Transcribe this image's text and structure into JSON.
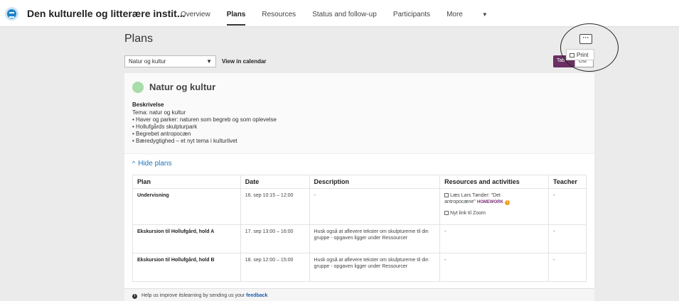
{
  "header": {
    "course_title": "Den kulturelle og litterære instit...",
    "nav": [
      "Overview",
      "Plans",
      "Resources",
      "Status and follow-up",
      "Participants",
      "More"
    ],
    "active_nav": "Plans"
  },
  "page": {
    "title": "Plans",
    "plan_select": "Natur og kultur",
    "calendar_link": "View in calendar",
    "view_toggle": [
      "Tab",
      "List"
    ],
    "more_button": "···",
    "print_label": "Print"
  },
  "plan": {
    "name": "Natur og kultur",
    "dot_color": "#a8dca8",
    "description_label": "Beskrivelse",
    "description_lines": [
      "Tema: natur og kultur",
      "• Haver og parker: naturen som begreb og som oplevelse",
      "• Hollufgårds skulpturpark",
      "• Begrebet antropocæn",
      "• Bæredygtighed – et nyt tema i kulturlivet"
    ],
    "hide_plans_label": "Hide plans"
  },
  "table": {
    "headers": [
      "Plan",
      "Date",
      "Description",
      "Resources and activities",
      "Teacher"
    ],
    "rows": [
      {
        "plan": "Undervisning",
        "date": "16. sep 10:15 – 12:00",
        "description": "-",
        "resource_1": "Læs Lars Tønder: \"Det antropocæne\"",
        "resource_1_tag": "HOMEWORK",
        "resource_2": "Nyt link til Zoom",
        "teacher": "-"
      },
      {
        "plan": "Ekskursion til Hollufgård, hold A",
        "date": "17. sep 13:00 – 16:00",
        "description": "Husk også at aflevere tekster om skulpturerne til din gruppe - opgaven ligger under Ressourcer",
        "resources": "-",
        "teacher": "-"
      },
      {
        "plan": "Ekskursion til Hollufgård, hold B",
        "date": "18. sep 12:00 – 15:00",
        "description": "Husk også at aflevere tekster om skulpturerne til din gruppe - opgaven ligger under Ressourcer",
        "resources": "-",
        "teacher": "-"
      }
    ]
  },
  "feedback": {
    "text": "Help us improve itslearning by sending us your",
    "link": "feedback"
  },
  "colors": {
    "accent": "#6b2f63",
    "link": "#1f73b7",
    "homework": "#7a2d79"
  }
}
